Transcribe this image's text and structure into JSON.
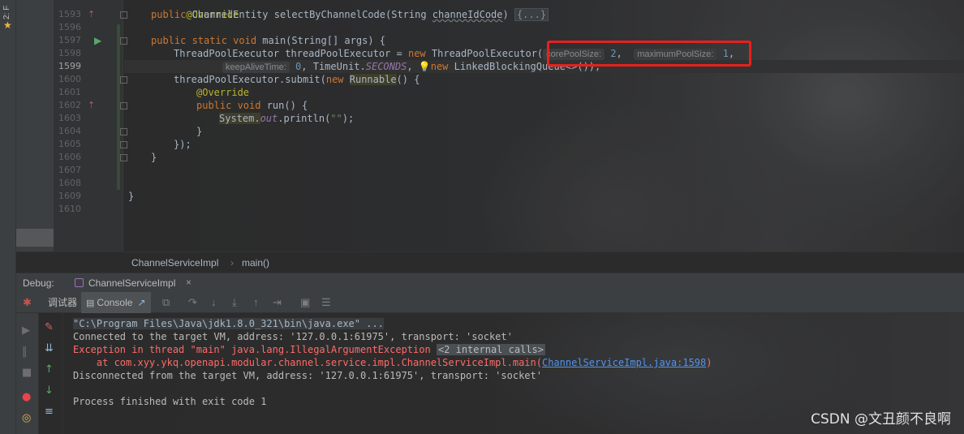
{
  "left_strip": {
    "tab_label": "2: F"
  },
  "editor": {
    "lines": [
      {
        "num": "1593"
      },
      {
        "num": "1596"
      },
      {
        "num": "1597"
      },
      {
        "num": "1598"
      },
      {
        "num": "1599"
      },
      {
        "num": "1600"
      },
      {
        "num": "1601"
      },
      {
        "num": "1602"
      },
      {
        "num": "1603"
      },
      {
        "num": "1604"
      },
      {
        "num": "1605"
      },
      {
        "num": "1606"
      },
      {
        "num": "1607"
      },
      {
        "num": "1608"
      },
      {
        "num": "1609"
      },
      {
        "num": "1610"
      }
    ],
    "code": {
      "l0_ann": "@Override",
      "l1_kw": "public ",
      "l1_type": "ChannelEntity selectByChannelCode(String ",
      "l1_param": "channeIdCode",
      "l1_tail": ") ",
      "l1_folded": "{...}",
      "l3_kw": "public static void ",
      "l3_rest": "main(String[] args) {",
      "l4_a": "ThreadPoolExecutor threadPoolExecutor = ",
      "l4_new": "new ",
      "l4_b": "ThreadPoolExecutor(",
      "hint_core": "corePoolSize:",
      "l4_core_val": "2",
      "hint_max": "maximumPoolSize:",
      "l4_max_val": "1",
      "hint_keep": "keepAliveTime:",
      "l5_val": "0",
      "l5_a": ", TimeUnit.",
      "l5_field": "SECONDS",
      "l5_b": ", ",
      "l5_new": "new ",
      "l5_c": "LinkedBlockingQueue<>());",
      "l6_a": "threadPoolExecutor.submit(",
      "l6_new": "new ",
      "l6_type": "Runnable",
      "l6_b": "() {",
      "l7_ann": "@Override",
      "l8_kw": "public void ",
      "l8_rest": "run() {",
      "l9_sys": "System.",
      "l9_out": "out",
      "l9_b": ".println(",
      "l9_str": "\"\"",
      "l9_c": ");",
      "l10": "}",
      "l11": "});",
      "l12": "}",
      "l15": "}"
    }
  },
  "breadcrumb": {
    "class_name": "ChannelServiceImpl",
    "method": "main()"
  },
  "debug": {
    "title": "Debug:",
    "tab": "ChannelServiceImpl",
    "debugger_tab": "调试器",
    "console_tab": "Console"
  },
  "console": {
    "cmd": "\"C:\\Program Files\\Java\\jdk1.8.0_321\\bin\\java.exe\" ...",
    "connected": "Connected to the target VM, address: '127.0.0.1:61975', transport: 'socket'",
    "exception": "Exception in thread \"main\" java.lang.IllegalArgumentException",
    "internal_calls": "<2 internal calls>",
    "at_prefix": "    at com.xyy.ykq.openapi.modular.channel.service.impl.ChannelServiceImpl.main(",
    "at_link": "ChannelServiceImpl.java:1598",
    "at_suffix": ")",
    "disconnected": "Disconnected from the target VM, address: '127.0.0.1:61975', transport: 'socket'",
    "finished": "Process finished with exit code 1"
  },
  "watermark": "CSDN @文丑颜不良啊",
  "colors": {
    "keyword": "#cc7832",
    "annotation": "#bbb529",
    "error": "#ff6b68",
    "link": "#5394ec",
    "highlight_box": "#e8201e"
  }
}
